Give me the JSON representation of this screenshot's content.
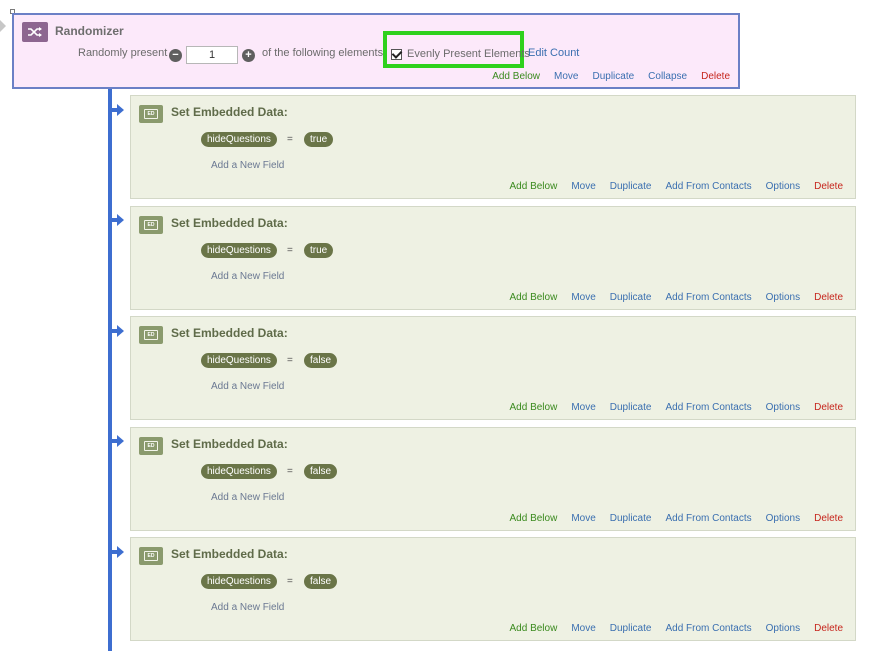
{
  "randomizer": {
    "title": "Randomizer",
    "randomly_present_label": "Randomly present",
    "count_value": "1",
    "following_label": "of the following elements",
    "evenly_present_label": "Evenly Present Elements",
    "evenly_present_checked": true,
    "edit_count_label": "Edit Count",
    "actions": {
      "add_below": "Add Below",
      "move": "Move",
      "duplicate": "Duplicate",
      "collapse": "Collapse",
      "delete": "Delete"
    }
  },
  "blocks": [
    {
      "title": "Set Embedded Data:",
      "icon_text": "ED",
      "field": "hideQuestions",
      "equals": "=",
      "value": "true",
      "add_field": "Add a New Field"
    },
    {
      "title": "Set Embedded Data:",
      "icon_text": "ED",
      "field": "hideQuestions",
      "equals": "=",
      "value": "true",
      "add_field": "Add a New Field"
    },
    {
      "title": "Set Embedded Data:",
      "icon_text": "ED",
      "field": "hideQuestions",
      "equals": "=",
      "value": "false",
      "add_field": "Add a New Field"
    },
    {
      "title": "Set Embedded Data:",
      "icon_text": "ED",
      "field": "hideQuestions",
      "equals": "=",
      "value": "false",
      "add_field": "Add a New Field"
    },
    {
      "title": "Set Embedded Data:",
      "icon_text": "ED",
      "field": "hideQuestions",
      "equals": "=",
      "value": "false",
      "add_field": "Add a New Field"
    }
  ],
  "block_actions": {
    "add_below": "Add Below",
    "move": "Move",
    "duplicate": "Duplicate",
    "add_from_contacts": "Add From Contacts",
    "options": "Options",
    "delete": "Delete"
  },
  "colors": {
    "randomizer_bg": "#fce9fa",
    "randomizer_border": "#6b80c6",
    "highlight": "#2fd11d",
    "block_bg": "#eef1e3",
    "pill_bg": "#6a7548",
    "timeline": "#3d6ed0",
    "link_green": "#3a8a1e",
    "link_blue": "#3a6fb0",
    "link_red": "#c6251c"
  },
  "icons": {
    "randomizer": "shuffle-icon",
    "block": "embedded-data-icon",
    "minus": "minus-circle-icon",
    "plus": "plus-circle-icon",
    "flow": "flow-arrow-icon"
  }
}
